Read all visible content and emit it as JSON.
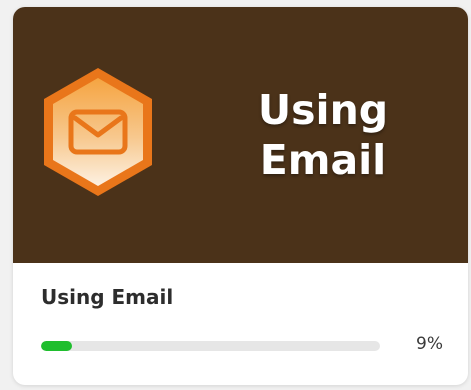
{
  "course": {
    "banner_title_line1": "Using",
    "banner_title_line2": "Email",
    "title": "Using Email",
    "badge_icon": "envelope-icon",
    "progress_fraction": 0.09,
    "progress_label": "9%"
  },
  "colors": {
    "banner_bg": "#4b3219",
    "badge_orange": "#e9761a",
    "progress_green": "#1fbe2e"
  }
}
